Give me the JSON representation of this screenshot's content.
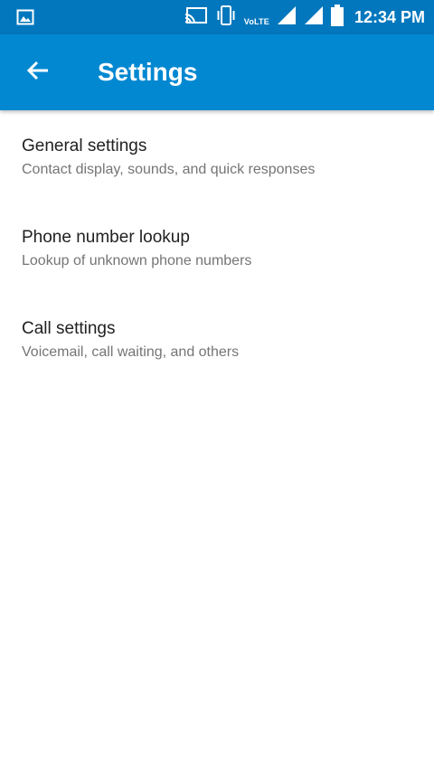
{
  "status_bar": {
    "time": "12:34 PM",
    "volte": "VoLTE",
    "icons": [
      "gallery-icon",
      "cast-icon",
      "vibrate-icon",
      "signal-icon",
      "signal-icon",
      "battery-icon"
    ]
  },
  "app_bar": {
    "title": "Settings",
    "back_icon": "arrow-left-icon"
  },
  "colors": {
    "status_bar": "#0277bd",
    "app_bar": "#0288d1",
    "title_text": "#212121",
    "summary_text": "#757575"
  },
  "settings": {
    "items": [
      {
        "title": "General settings",
        "summary": "Contact display, sounds, and quick responses"
      },
      {
        "title": "Phone number lookup",
        "summary": "Lookup of unknown phone numbers"
      },
      {
        "title": "Call settings",
        "summary": "Voicemail, call waiting, and others"
      }
    ]
  }
}
